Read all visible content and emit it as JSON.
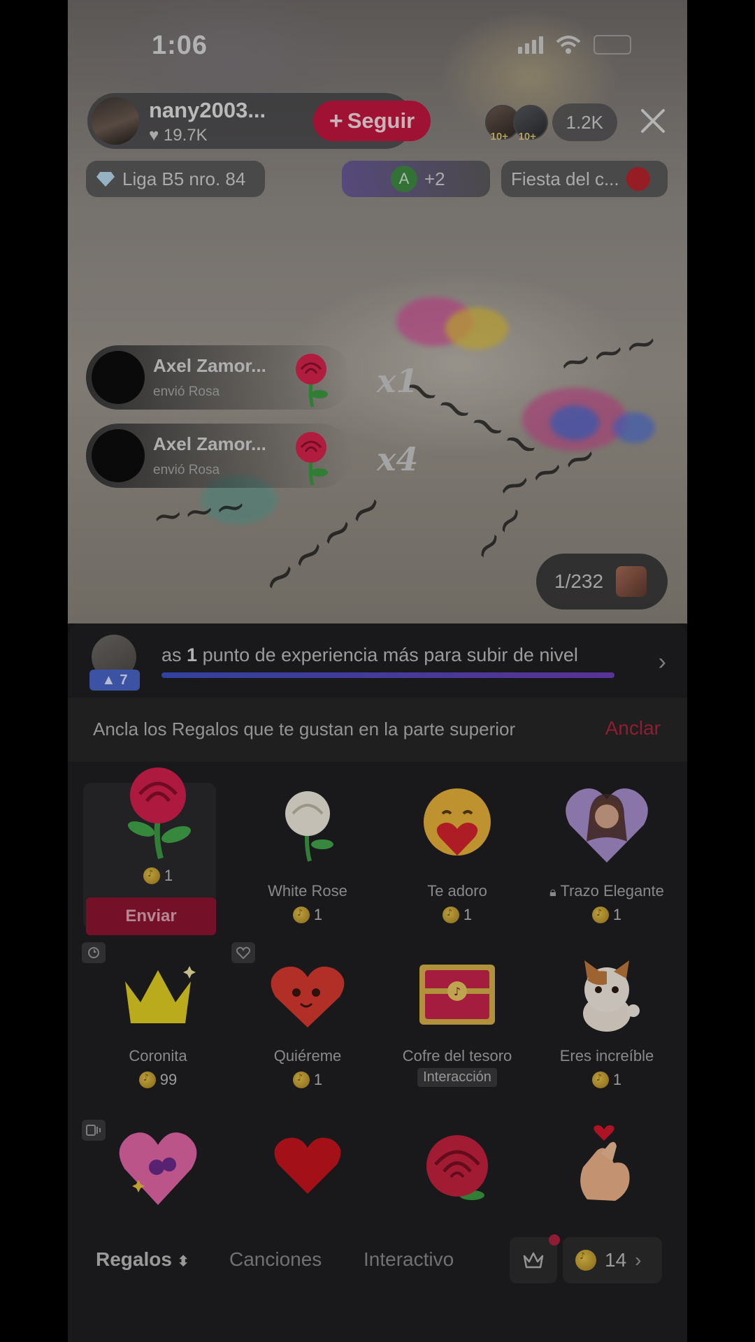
{
  "status_bar": {
    "time": "1:06"
  },
  "host": {
    "name": "nany2003...",
    "likes": "19.7K",
    "follow_label": "Seguir"
  },
  "viewers": {
    "badge_1": "10+",
    "badge_2": "10+",
    "count": "1.2K"
  },
  "chips": {
    "league": "Liga B5 nro. 84",
    "avatar_letter": "A",
    "plus_count": "+2",
    "event": "Fiesta del c..."
  },
  "gift_alerts": [
    {
      "name": "Axel Zamor...",
      "action": "envió Rosa",
      "count": "x1"
    },
    {
      "name": "Axel Zamor...",
      "action": "envió Rosa",
      "count": "x4"
    }
  ],
  "room_counter": "1/232",
  "level": {
    "badge_level": "7",
    "text_prefix": "as ",
    "text_points": "1",
    "text_suffix": " punto de experiencia más para subir de nivel"
  },
  "pin_banner": {
    "text": "Ancla los Regalos que te gustan en la parte superior",
    "action": "Anclar"
  },
  "gifts": [
    {
      "name": "",
      "price": "1",
      "send_label": "Enviar",
      "icon": "rose-icon"
    },
    {
      "name": "White Rose",
      "price": "1",
      "icon": "white-rose-icon"
    },
    {
      "name": "Te adoro",
      "price": "1",
      "icon": "hug-heart-icon"
    },
    {
      "name": "Trazo Elegante",
      "price": "1",
      "icon": "portrait-heart-icon",
      "locked": true
    },
    {
      "name": "Coronita",
      "price": "99",
      "icon": "crown-icon"
    },
    {
      "name": "Quiéreme",
      "price": "1",
      "icon": "love-heart-icon"
    },
    {
      "name": "Cofre del tesoro",
      "tag": "Interacción",
      "icon": "treasure-chest-icon"
    },
    {
      "name": "Eres increíble",
      "price": "1",
      "icon": "cat-icon"
    },
    {
      "name": "",
      "icon": "pink-heart-icon"
    },
    {
      "name": "",
      "icon": "red-heart-icon"
    },
    {
      "name": "",
      "icon": "red-rose-icon"
    },
    {
      "name": "",
      "icon": "finger-heart-icon"
    }
  ],
  "tabs": {
    "gifts": "Regalos",
    "songs": "Canciones",
    "interactive": "Interactivo"
  },
  "balance": "14",
  "colors": {
    "accent": "#c4173f",
    "level_badge": "#4a66c7",
    "coin": "#e6c34a"
  }
}
